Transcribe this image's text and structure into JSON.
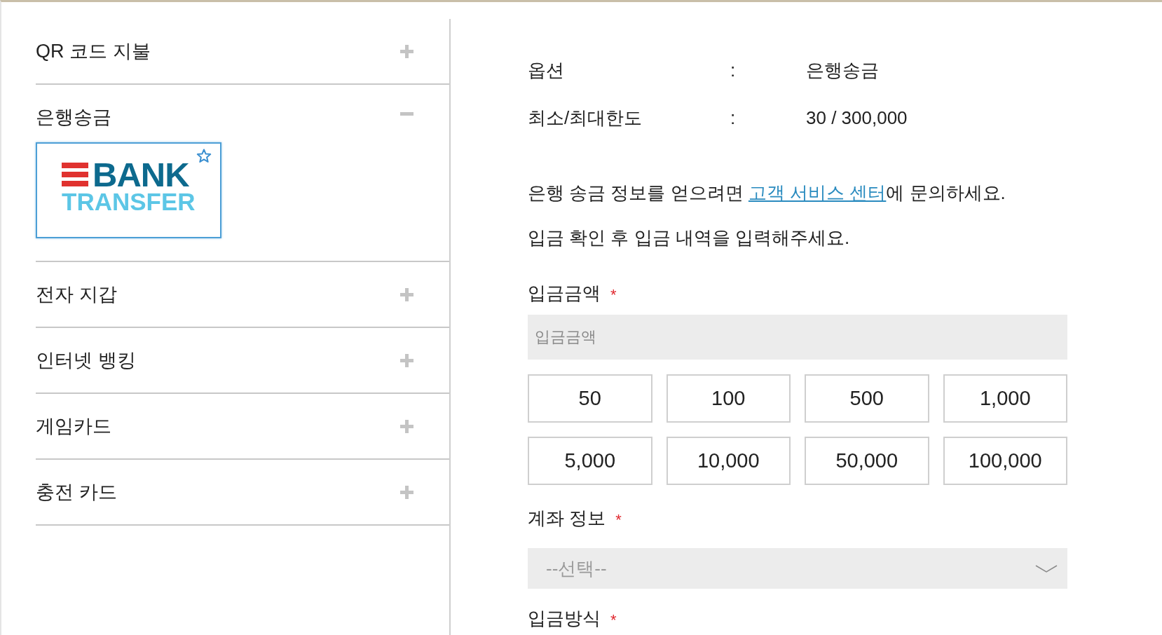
{
  "payment_methods": [
    {
      "label": "QR 코드 지불",
      "expanded": false
    },
    {
      "label": "은행송금",
      "expanded": true,
      "logo": {
        "line_1": "BANK",
        "line_2": "TRANSFER"
      }
    },
    {
      "label": "전자 지갑",
      "expanded": false
    },
    {
      "label": "인터넷 뱅킹",
      "expanded": false
    },
    {
      "label": "게임카드",
      "expanded": false
    },
    {
      "label": "충전 카드",
      "expanded": false
    }
  ],
  "details": {
    "info_rows": [
      {
        "label": "옵션",
        "separator": ":",
        "value": "은행송금"
      },
      {
        "label": "최소/최대한도",
        "separator": ":",
        "value": "30 / 300,000"
      }
    ],
    "notice": {
      "before": "은행 송금 정보를 얻으려면 ",
      "link": "고객 서비스 센터",
      "after": "에 문의하세요."
    },
    "instruction": "입금 확인 후 입금 내역을 입력해주세요."
  },
  "form": {
    "amount": {
      "label": "입금금액",
      "required_mark": "*",
      "placeholder": "입금금액"
    },
    "quick_amounts": [
      "50",
      "100",
      "500",
      "1,000",
      "5,000",
      "10,000",
      "50,000",
      "100,000"
    ],
    "account": {
      "label": "계좌 정보",
      "required_mark": "*",
      "placeholder": "--선택--"
    },
    "method": {
      "label": "입금방식",
      "required_mark": "*"
    }
  }
}
